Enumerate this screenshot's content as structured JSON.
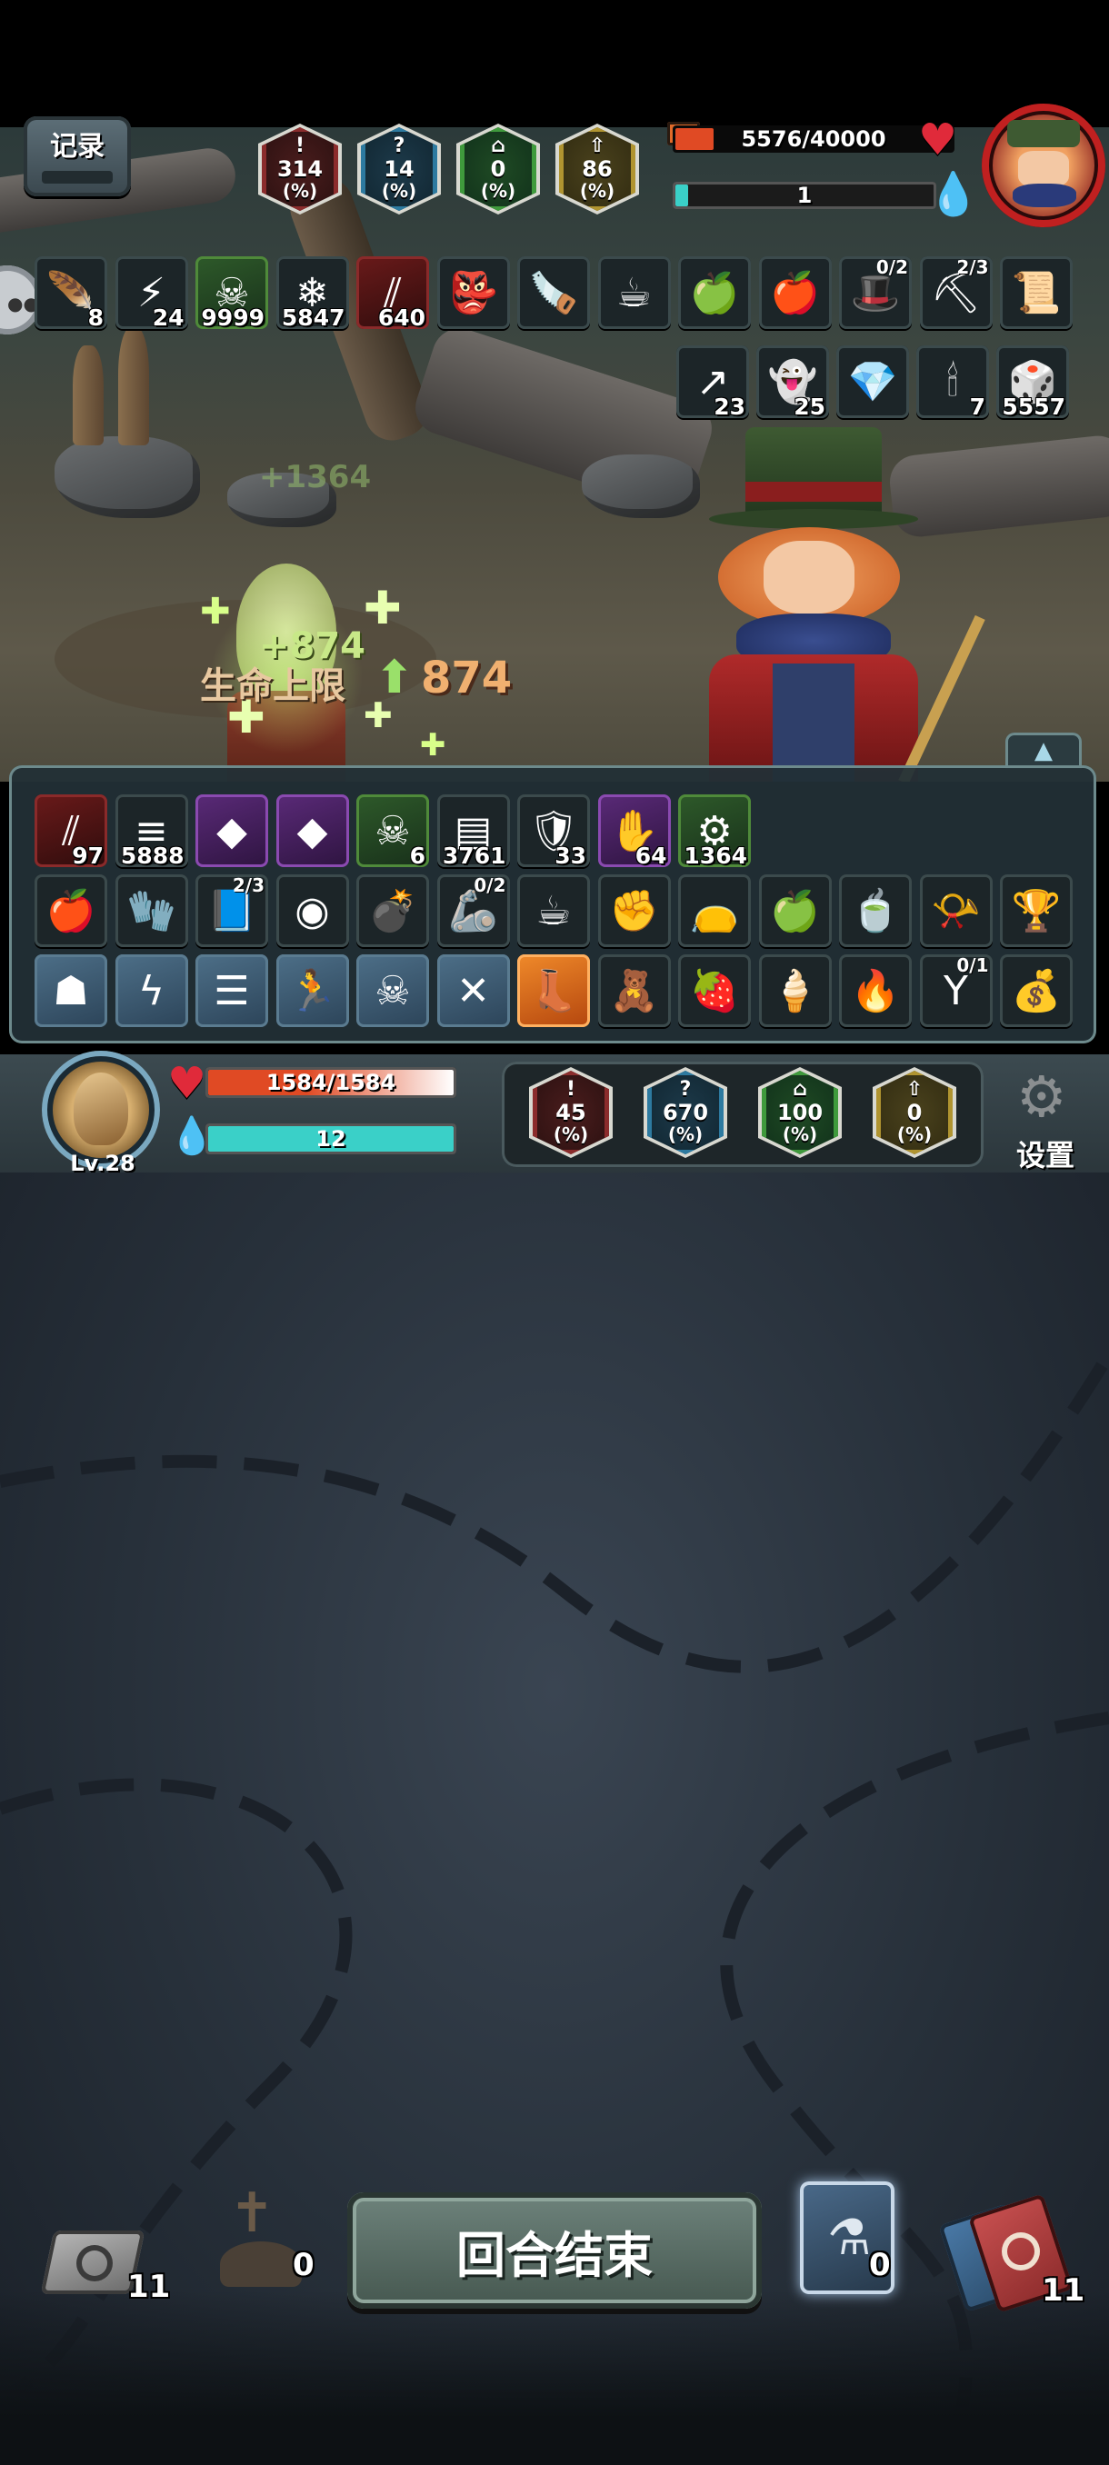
{
  "enemy": {
    "stats": [
      {
        "icon": "red-exclamation-icon",
        "value": "314",
        "unit": "(%)"
      },
      {
        "icon": "blue-question-icon",
        "value": "14",
        "unit": "(%)"
      },
      {
        "icon": "green-castle-icon",
        "value": "0",
        "unit": "(%)"
      },
      {
        "icon": "gold-arrow-icon",
        "value": "86",
        "unit": "(%)"
      }
    ],
    "hp_text": "5576/40000",
    "hp_fraction": 0.1394,
    "mana_text": "1",
    "mana_fraction": 0.05,
    "buffs_row1": [
      {
        "icon": "feather-icon",
        "value": "8"
      },
      {
        "icon": "lightning-icon",
        "value": "24"
      },
      {
        "icon": "poison-skull-icon",
        "value": "9999"
      },
      {
        "icon": "snowflake-icon",
        "value": "5847"
      },
      {
        "icon": "claw-slash-icon",
        "value": "640"
      },
      {
        "icon": "red-imp-icon",
        "value": ""
      },
      {
        "icon": "chainsaw-icon",
        "value": ""
      },
      {
        "icon": "teacup-icon",
        "value": ""
      },
      {
        "icon": "blue-apple-icon",
        "value": ""
      },
      {
        "icon": "fire-fruit-icon",
        "value": ""
      },
      {
        "icon": "green-hat-icon",
        "value": "",
        "frac": "0/2"
      },
      {
        "icon": "pickaxe-icon",
        "value": "",
        "frac": "2/3"
      },
      {
        "icon": "green-scroll-icon",
        "value": ""
      }
    ],
    "buffs_row2": [
      {
        "icon": "blue-arrow-icon",
        "value": "23"
      },
      {
        "icon": "spirit-face-icon",
        "value": "25"
      },
      {
        "icon": "purple-gem-icon",
        "value": ""
      },
      {
        "icon": "candle-icon",
        "value": "7"
      },
      {
        "icon": "dice-icon",
        "value": "5557"
      }
    ]
  },
  "record_button": "记录",
  "floating": {
    "heal": "+874",
    "faded_heal": "+1364",
    "maxhp_label": "生命上限",
    "maxhp_value": "874"
  },
  "player": {
    "buffs": [
      {
        "icon": "claw-slash-icon",
        "value": "97"
      },
      {
        "icon": "green-beam-icon",
        "value": "5888"
      },
      {
        "icon": "crystal-shard-icon",
        "value": ""
      },
      {
        "icon": "crystal-shard-icon",
        "value": ""
      },
      {
        "icon": "poison-skull-icon",
        "value": "6"
      },
      {
        "icon": "paper-stack-icon",
        "value": "3761"
      },
      {
        "icon": "blue-shield-icon",
        "value": "33"
      },
      {
        "icon": "shadow-hand-icon",
        "value": "64"
      },
      {
        "icon": "green-gear-icon",
        "value": "1364"
      }
    ],
    "relics_row1": [
      {
        "icon": "fire-fruit-icon",
        "frac": ""
      },
      {
        "icon": "red-glove-icon",
        "frac": ""
      },
      {
        "icon": "spellbook-icon",
        "frac": "2/3"
      },
      {
        "icon": "goggles-icon",
        "frac": ""
      },
      {
        "icon": "bomb-icon",
        "frac": ""
      },
      {
        "icon": "gauntlet-icon",
        "frac": "0/2"
      },
      {
        "icon": "teacup-icon",
        "frac": ""
      },
      {
        "icon": "fist-icon",
        "frac": ""
      },
      {
        "icon": "potion-bag-icon",
        "frac": ""
      },
      {
        "icon": "blue-apple-icon",
        "frac": ""
      },
      {
        "icon": "green-teacup-icon",
        "frac": ""
      },
      {
        "icon": "red-horn-icon",
        "frac": ""
      },
      {
        "icon": "golden-goblet-icon",
        "frac": ""
      }
    ],
    "relics_row2": [
      {
        "icon": "bat-skull-icon",
        "frac": "",
        "style": "bluebg"
      },
      {
        "icon": "lightning-crack-icon",
        "frac": "",
        "style": "bluebg"
      },
      {
        "icon": "equals-rune-icon",
        "frac": "",
        "style": "bluebg"
      },
      {
        "icon": "running-figure-icon",
        "frac": "",
        "style": "bluebg"
      },
      {
        "icon": "skull-rune-icon",
        "frac": "",
        "style": "bluebg"
      },
      {
        "icon": "cross-swords-icon",
        "frac": "",
        "style": "bluebg"
      },
      {
        "icon": "boot-icon",
        "frac": "",
        "style": "orange"
      },
      {
        "icon": "doll-icon",
        "frac": "",
        "style": ""
      },
      {
        "icon": "strawberry-icon",
        "frac": "",
        "style": ""
      },
      {
        "icon": "ice-cream-icon",
        "frac": "",
        "style": ""
      },
      {
        "icon": "torch-icon",
        "frac": "",
        "style": ""
      },
      {
        "icon": "slingshot-icon",
        "frac": "0/1",
        "style": ""
      },
      {
        "icon": "sack-icon",
        "frac": "",
        "style": ""
      }
    ],
    "level": "Lv.28",
    "hp_text": "1584/1584",
    "hp_fraction": 1.0,
    "mana_text": "12",
    "mana_fraction": 1.0,
    "stats": [
      {
        "icon": "red-exclamation-icon",
        "value": "45",
        "unit": "(%)"
      },
      {
        "icon": "blue-question-icon",
        "value": "670",
        "unit": "(%)"
      },
      {
        "icon": "green-castle-icon",
        "value": "100",
        "unit": "(%)"
      },
      {
        "icon": "gold-arrow-icon",
        "value": "0",
        "unit": "(%)"
      }
    ],
    "settings_label": "设置"
  },
  "bottom": {
    "draw_pile_count": "11",
    "grave_count": "0",
    "end_turn_label": "回合结束",
    "potion_count": "0",
    "discard_pile_count": "11"
  },
  "colors": {
    "hp_red": "#e04a24",
    "mana_teal": "#3ad0c8",
    "panel_border": "#6d8a8c"
  }
}
